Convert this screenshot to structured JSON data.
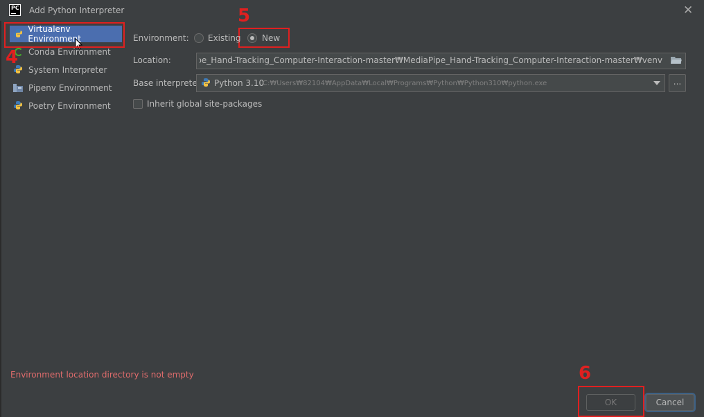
{
  "window": {
    "title": "Add Python Interpreter",
    "app_icon_text": "PC"
  },
  "sidebar": {
    "items": [
      {
        "label": "Virtualenv Environment",
        "icon": "python-icon",
        "selected": true
      },
      {
        "label": "Conda Environment",
        "icon": "conda-icon",
        "selected": false
      },
      {
        "label": "System Interpreter",
        "icon": "python-icon",
        "selected": false
      },
      {
        "label": "Pipenv Environment",
        "icon": "pipenv-icon",
        "selected": false
      },
      {
        "label": "Poetry Environment",
        "icon": "poetry-icon",
        "selected": false
      }
    ]
  },
  "annotations": {
    "step4": "4",
    "step5": "5",
    "step6": "6",
    "color": "#e02020"
  },
  "form": {
    "environment_label": "Environment:",
    "existing_label": "Existing",
    "new_label": "New",
    "selected_environment": "New",
    "location_label": "Location:",
    "location_value": "ads₩MediaPipe_Hand-Tracking_Computer-Interaction-master₩MediaPipe_Hand-Tracking_Computer-Interaction-master₩venv",
    "base_interpreter_label": "Base interpreter:",
    "base_interpreter_name": "Python 3.10",
    "base_interpreter_path": "C:₩Users₩82104₩AppData₩Local₩Programs₩Python₩Python310₩python.exe",
    "browse_label": "...",
    "inherit_label": "Inherit global site-packages",
    "inherit_checked": false
  },
  "error_message": "Environment location directory is not empty",
  "buttons": {
    "ok": "OK",
    "cancel": "Cancel"
  },
  "colors": {
    "selection": "#4b6eaf",
    "background": "#3c3f41",
    "error": "#e06c6c"
  }
}
